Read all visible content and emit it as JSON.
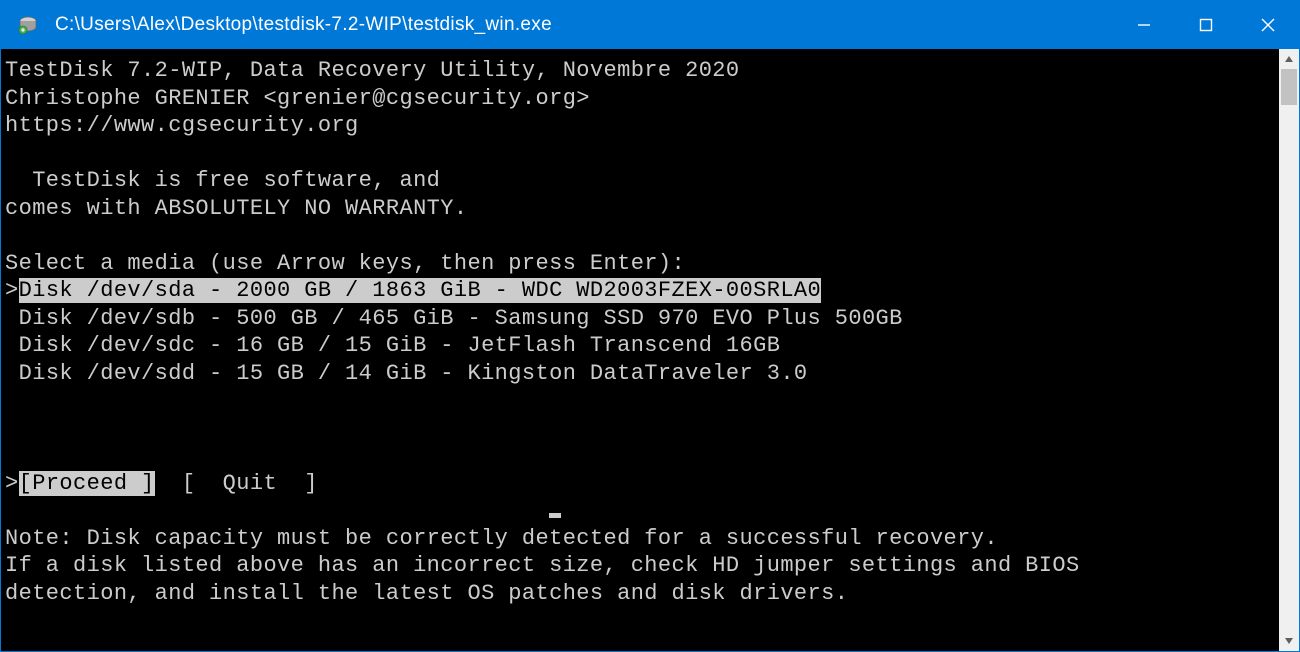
{
  "titlebar": {
    "path": "C:\\Users\\Alex\\Desktop\\testdisk-7.2-WIP\\testdisk_win.exe"
  },
  "header": {
    "line1": "TestDisk 7.2-WIP, Data Recovery Utility, Novembre 2020",
    "line2": "Christophe GRENIER <grenier@cgsecurity.org>",
    "line3": "https://www.cgsecurity.org"
  },
  "license": {
    "line1": "  TestDisk is free software, and",
    "line2": "comes with ABSOLUTELY NO WARRANTY."
  },
  "select_prompt": "Select a media (use Arrow keys, then press Enter):",
  "disks": [
    {
      "prefix": ">",
      "text": "Disk /dev/sda - 2000 GB / 1863 GiB - WDC WD2003FZEX-00SRLA0",
      "selected": true
    },
    {
      "prefix": " ",
      "text": "Disk /dev/sdb - 500 GB / 465 GiB - Samsung SSD 970 EVO Plus 500GB",
      "selected": false
    },
    {
      "prefix": " ",
      "text": "Disk /dev/sdc - 16 GB / 15 GiB - JetFlash Transcend 16GB",
      "selected": false
    },
    {
      "prefix": " ",
      "text": "Disk /dev/sdd - 15 GB / 14 GiB - Kingston DataTraveler 3.0",
      "selected": false
    }
  ],
  "actions": {
    "caret": ">",
    "proceed": "[Proceed ]",
    "gap": "  ",
    "quit": "[  Quit  ]"
  },
  "note": {
    "line1": "Note: Disk capacity must be correctly detected for a successful recovery.",
    "line2": "If a disk listed above has an incorrect size, check HD jumper settings and BIOS",
    "line3": "detection, and install the latest OS patches and disk drivers."
  }
}
